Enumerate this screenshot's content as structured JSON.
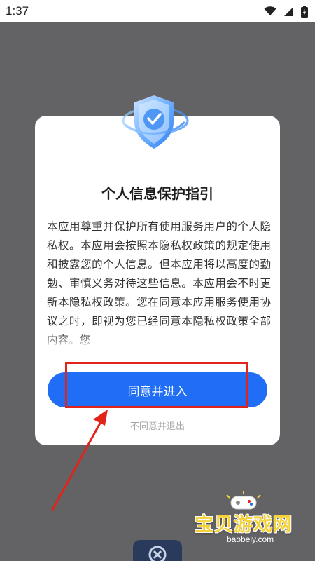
{
  "status_bar": {
    "time": "1:37",
    "icons": [
      "wifi-icon",
      "cellular-signal-icon",
      "battery-icon"
    ]
  },
  "dialog": {
    "title": "个人信息保护指引",
    "body": "本应用尊重并保护所有使用服务用户的个人隐私权。本应用会按照本隐私权政策的规定使用和披露您的个人信息。但本应用将以高度的勤勉、审慎义务对待这些信息。本应用会不时更新本隐私权政策。您在同意本应用服务使用协议之时，即视为您已经同意本隐私权政策全部内容。您",
    "agree_label": "同意并进入",
    "disagree_label": "不同意并退出",
    "icon": "shield-check-icon"
  },
  "annotation": {
    "color": "#e2231a"
  },
  "watermark": {
    "brand": "宝贝游戏网",
    "url": "baobeiy.com"
  },
  "colors": {
    "accent": "#1f6ef5",
    "overlay": "#636366"
  }
}
